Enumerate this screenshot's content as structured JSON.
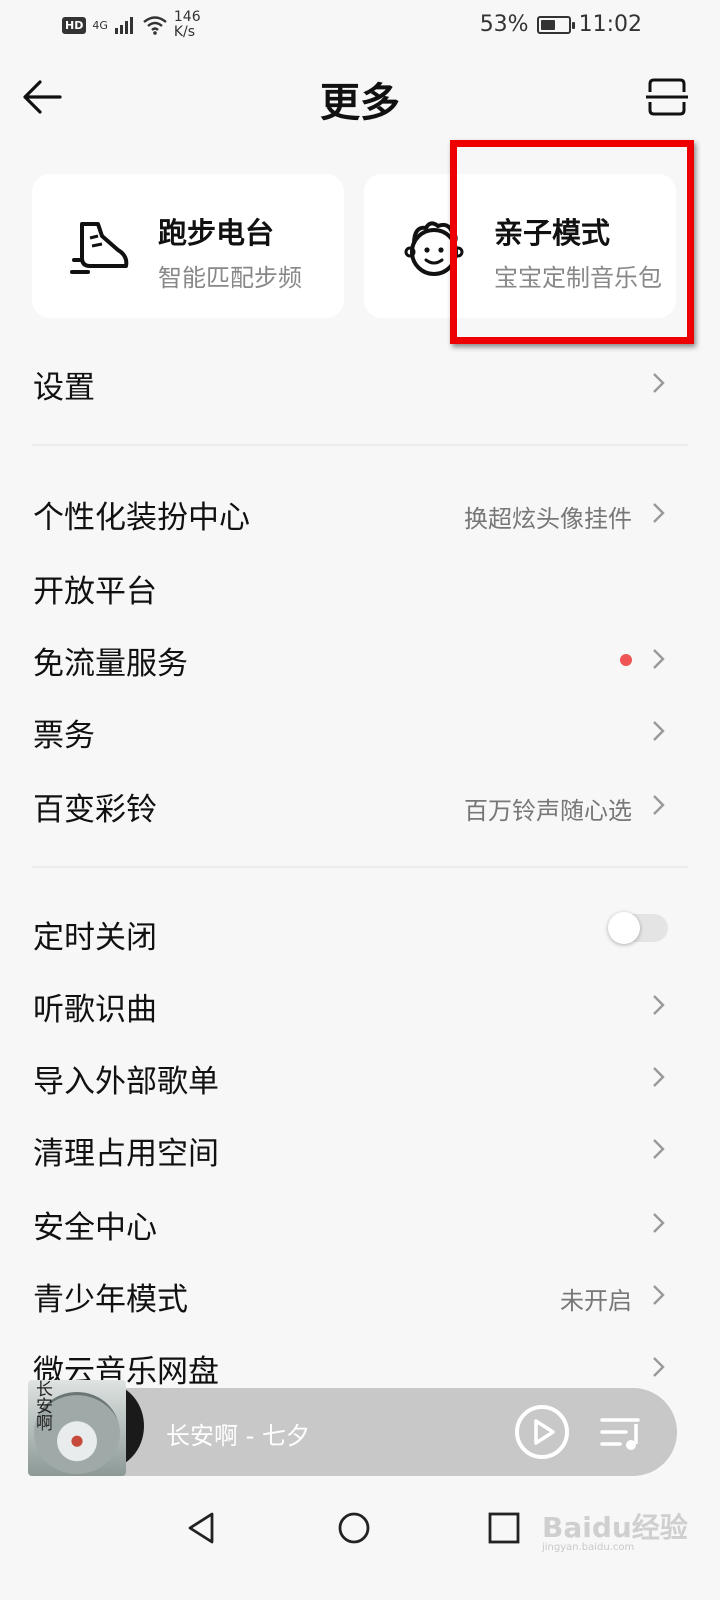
{
  "status_bar": {
    "hd": "HD",
    "network": "4G",
    "speed_value": "146",
    "speed_unit": "K/s",
    "battery_text": "53%",
    "battery_level": 0.53,
    "time": "11:02"
  },
  "header": {
    "title": "更多"
  },
  "cards": [
    {
      "title": "跑步电台",
      "subtitle": "智能匹配步频",
      "icon": "running-shoe-icon"
    },
    {
      "title": "亲子模式",
      "subtitle": "宝宝定制音乐包",
      "icon": "child-face-icon"
    }
  ],
  "highlight_color": "#ee0000",
  "menu": {
    "settings": {
      "label": "设置"
    },
    "personalize": {
      "label": "个性化装扮中心",
      "value": "换超炫头像挂件"
    },
    "open_platform": {
      "label": "开放平台"
    },
    "free_data": {
      "label": "免流量服务",
      "has_dot": true
    },
    "tickets": {
      "label": "票务"
    },
    "ringtone": {
      "label": "百变彩铃",
      "value": "百万铃声随心选"
    },
    "sleep_timer": {
      "label": "定时关闭",
      "toggle_on": false
    },
    "song_recognition": {
      "label": "听歌识曲"
    },
    "import_playlist": {
      "label": "导入外部歌单"
    },
    "clean_space": {
      "label": "清理占用空间"
    },
    "security": {
      "label": "安全中心"
    },
    "teen_mode": {
      "label": "青少年模式",
      "value": "未开启"
    },
    "cloud_disk": {
      "label": "微云音乐网盘"
    }
  },
  "player": {
    "song": "长安啊 - 七夕",
    "album_text": "长安啊",
    "icons": [
      "play-icon",
      "playlist-icon"
    ]
  },
  "watermark": {
    "brand": "Baidu经验",
    "url": "jingyan.baidu.com"
  },
  "colors": {
    "accent_dot": "#ee5555",
    "background": "#f7f7f7"
  }
}
